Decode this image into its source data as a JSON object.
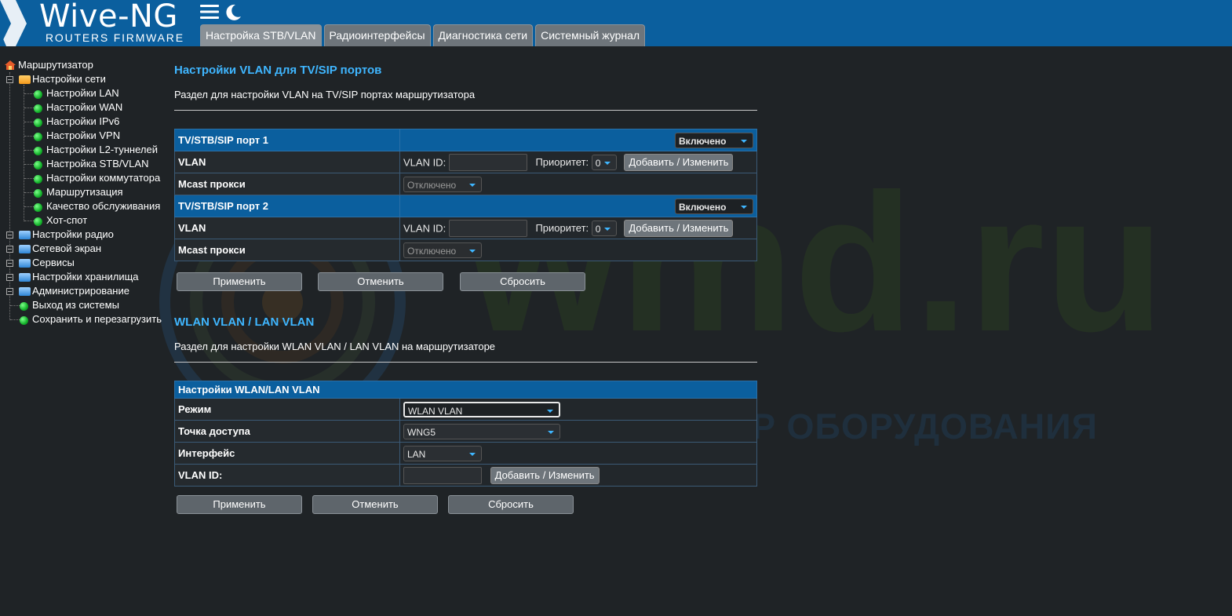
{
  "header": {
    "logo_title": "Wive-NG",
    "logo_subtitle": "ROUTERS FIRMWARE",
    "brand_color": "#0b5f9e",
    "icons": [
      "menu-icon",
      "moon-icon"
    ],
    "tabs": [
      {
        "label": "Настройка STB/VLAN",
        "active": true
      },
      {
        "label": "Радиоинтерфейсы",
        "active": false
      },
      {
        "label": "Диагностика сети",
        "active": false
      },
      {
        "label": "Системный журнал",
        "active": false
      }
    ]
  },
  "sidebar": {
    "root": "Маршрутизатор",
    "network_folder": "Настройки сети",
    "network_items": [
      "Настройки LAN",
      "Настройки WAN",
      "Настройки IPv6",
      "Настройки VPN",
      "Настройки L2-туннелей",
      "Настройка STB/VLAN",
      "Настройки коммутатора",
      "Маршрутизация",
      "Качество обслуживания",
      "Хот-спот"
    ],
    "folders": [
      "Настройки радио",
      "Сетевой экран",
      "Сервисы",
      "Настройки хранилища",
      "Администрирование"
    ],
    "leaves": [
      "Выход из системы",
      "Сохранить и перезагрузить"
    ]
  },
  "vlan_section": {
    "title": "Настройки VLAN для TV/SIP портов",
    "description": "Раздел для настройки VLAN на TV/SIP портах маршрутизатора",
    "ports": [
      {
        "header": "TV/STB/SIP порт 1",
        "state": "Включено",
        "vlan_label": "VLAN",
        "vlan_id_label": "VLAN ID:",
        "vlan_id_value": "",
        "priority_label": "Приоритет:",
        "priority_value": "0",
        "add_button": "Добавить / Изменить",
        "mcast_label": "Mcast прокси",
        "mcast_value": "Отключено"
      },
      {
        "header": "TV/STB/SIP порт 2",
        "state": "Включено",
        "vlan_label": "VLAN",
        "vlan_id_label": "VLAN ID:",
        "vlan_id_value": "",
        "priority_label": "Приоритет:",
        "priority_value": "0",
        "add_button": "Добавить / Изменить",
        "mcast_label": "Mcast прокси",
        "mcast_value": "Отключено"
      }
    ],
    "buttons": {
      "apply": "Применить",
      "cancel": "Отменить",
      "reset": "Сбросить"
    }
  },
  "wlan_section": {
    "title": "WLAN VLAN / LAN VLAN",
    "description": "Раздел для настройки WLAN VLAN / LAN VLAN на маршрутизаторе",
    "table_header": "Настройки WLAN/LAN VLAN",
    "mode_label": "Режим",
    "mode_value": "WLAN VLAN",
    "ap_label": "Точка доступа",
    "ap_value": "WNG5",
    "iface_label": "Интерфейс",
    "iface_value": "LAN",
    "vlan_id_label": "VLAN ID:",
    "vlan_id_value": "",
    "add_button": "Добавить / Изменить",
    "buttons": {
      "apply": "Применить",
      "cancel": "Отменить",
      "reset": "Сбросить"
    }
  },
  "watermark": {
    "brand": "wmd.ru",
    "tagline": "ДИСТРИБЬЮТОР ОБОРУДОВАНИЯ СВЯЗИ"
  }
}
